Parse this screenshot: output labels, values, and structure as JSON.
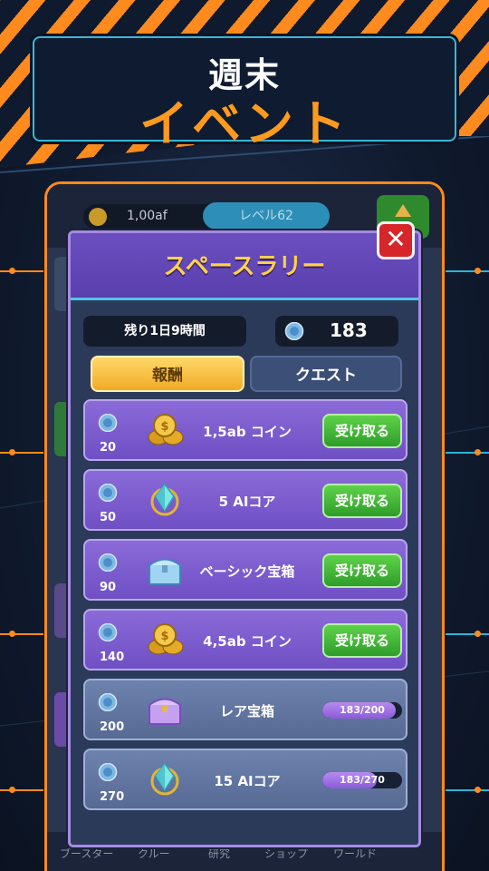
{
  "banner": {
    "line1": "週末",
    "line2": "イベント"
  },
  "game": {
    "coins": "1,00af",
    "level": "レベル62",
    "nav": [
      "ブースター",
      "クルー",
      "研究",
      "ショップ",
      "ワールド"
    ]
  },
  "modal": {
    "title": "スペースラリー",
    "close_label": "✕",
    "timer": "残り1日9時間",
    "points": "183",
    "tabs": {
      "rewards": "報酬",
      "quests": "クエスト"
    },
    "rewards": [
      {
        "cost": "20",
        "label": "1,5ab コイン",
        "icon": "coin-stack-icon",
        "action": "受け取る"
      },
      {
        "cost": "50",
        "label": "5 AIコア",
        "icon": "ai-core-icon",
        "action": "受け取る"
      },
      {
        "cost": "90",
        "label": "ベーシック宝箱",
        "icon": "chest-icon",
        "action": "受け取る"
      },
      {
        "cost": "140",
        "label": "4,5ab コイン",
        "icon": "coin-stack-icon",
        "action": "受け取る"
      },
      {
        "cost": "200",
        "label": "レア宝箱",
        "icon": "chest-icon",
        "progress_text": "183/200",
        "progress": 0.915
      },
      {
        "cost": "270",
        "label": "15 AIコア",
        "icon": "ai-core-icon",
        "progress_text": "183/270",
        "progress": 0.678
      }
    ]
  },
  "colors": {
    "accent": "#ff8a1d",
    "title": "#ffd24a",
    "claim": "#3cb836"
  }
}
